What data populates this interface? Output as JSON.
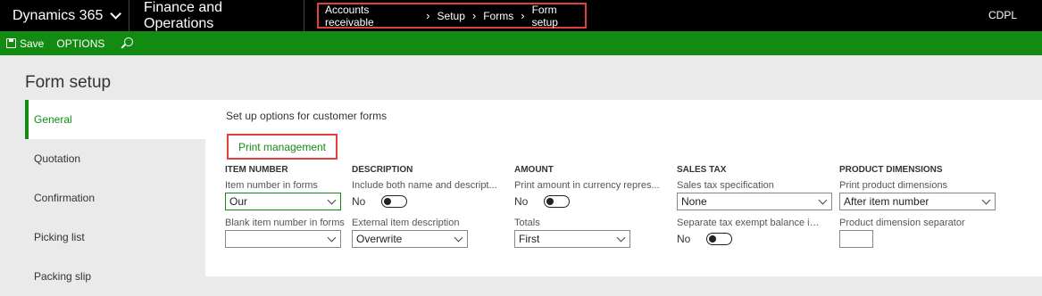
{
  "topbar": {
    "app_name": "Dynamics 365",
    "module": "Finance and Operations",
    "breadcrumb": [
      "Accounts receivable",
      "Setup",
      "Forms",
      "Form setup"
    ],
    "company": "CDPL"
  },
  "actionbar": {
    "save_label": "Save",
    "options_label": "OPTIONS"
  },
  "page": {
    "title": "Form setup"
  },
  "tabs": [
    "General",
    "Quotation",
    "Confirmation",
    "Picking list",
    "Packing slip"
  ],
  "content": {
    "intro": "Set up options for customer forms",
    "print_management": "Print management",
    "columns": {
      "item_number": {
        "heading": "ITEM NUMBER",
        "item_number_in_forms_label": "Item number in forms",
        "item_number_in_forms_value": "Our",
        "blank_item_number_label": "Blank item number in forms",
        "blank_item_number_value": ""
      },
      "description": {
        "heading": "DESCRIPTION",
        "include_both_label": "Include both name and descript...",
        "include_both_value": "No",
        "external_desc_label": "External item description",
        "external_desc_value": "Overwrite"
      },
      "amount": {
        "heading": "AMOUNT",
        "print_currency_label": "Print amount in currency repres...",
        "print_currency_value": "No",
        "totals_label": "Totals",
        "totals_value": "First"
      },
      "sales_tax": {
        "heading": "SALES TAX",
        "spec_label": "Sales tax specification",
        "spec_value": "None",
        "separate_label": "Separate tax exempt balance in ...",
        "separate_value": "No"
      },
      "product_dimensions": {
        "heading": "PRODUCT DIMENSIONS",
        "print_dims_label": "Print product dimensions",
        "print_dims_value": "After item number",
        "separator_label": "Product dimension separator",
        "separator_value": ""
      }
    }
  }
}
